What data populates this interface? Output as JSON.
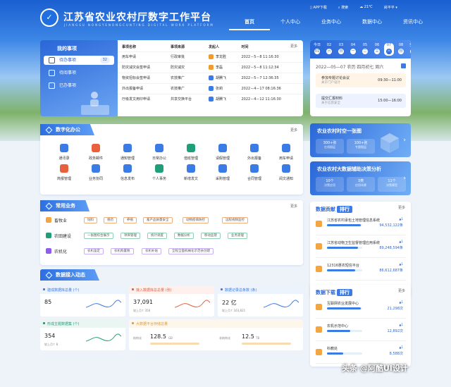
{
  "header": {
    "site_title": "江苏省农业农村厅数字工作平台",
    "site_subtitle": "JIANGSU NONGYENONGCUNTING DIGITAL WORK PLATFORM",
    "logo_text": "✓",
    "topbar": [
      "APP下载",
      "搜索",
      "21℃",
      "尚平平"
    ],
    "nav": [
      "首页",
      "个人中心",
      "业务中心",
      "数据中心",
      "资讯中心"
    ],
    "nav_active": "首页"
  },
  "todo": {
    "title": "我的事项",
    "items": [
      {
        "label": "待办事项",
        "count": "32"
      },
      {
        "label": "待阅事项"
      },
      {
        "label": "已办事项"
      }
    ]
  },
  "tasks": {
    "columns": [
      "事项名称",
      "事项来源",
      "发起人",
      "时间"
    ],
    "more": "更多",
    "rows": [
      {
        "name": "用车申请",
        "source": "行政审批",
        "person": "李龙胜",
        "time": "2022－5－8 11:16:30",
        "color": "#f19b2c"
      },
      {
        "name": "防灾减灾会签申请",
        "source": "防灾减灾",
        "person": "李磊",
        "time": "2022－5－8 11:12:34",
        "color": "#f19b2c"
      },
      {
        "name": "物资招标会签申请",
        "source": "农技推广",
        "person": "胡腾飞",
        "time": "2022－5－7 12:36:35",
        "color": "#3a7be6"
      },
      {
        "name": "外出报备申请",
        "source": "农技推广",
        "person": "张莉",
        "time": "2022－4－17 08:16:36",
        "color": "#3a7be6"
      },
      {
        "name": "厅级发文用印申请",
        "source": "共享交换平台",
        "person": "胡腾飞",
        "time": "2022－4－12 11:16:30",
        "color": "#3a7be6"
      }
    ]
  },
  "calendar": {
    "days": [
      {
        "top": "今日",
        "num": "01"
      },
      {
        "top": "02",
        "num": "六"
      },
      {
        "top": "03",
        "num": "日"
      },
      {
        "top": "04",
        "num": "一"
      },
      {
        "top": "05",
        "num": "二"
      },
      {
        "top": "06",
        "num": "三"
      },
      {
        "top": "07",
        "num": "六"
      },
      {
        "top": "08",
        "num": "日"
      },
      {
        "top": "全部",
        "num": "五"
      }
    ],
    "active_index": 6,
    "date_line": "2022—05—07  农历  四月初七  周六",
    "events": [
      {
        "title": "参加专题讨论会议",
        "sub": "关于门户设计",
        "time": "09:30—11:00"
      },
      {
        "title": "提交汇报材料",
        "sub": "关于信息安全",
        "time": "15:00—16:00"
      }
    ]
  },
  "panel_time": {
    "title": "农业农村时空一张图",
    "stats": [
      {
        "value": "300+张",
        "label": "在线图层"
      },
      {
        "value": "100+张",
        "label": "专题图层"
      }
    ]
  },
  "panel_ai": {
    "title": "农业农村大数据辅助决策分析",
    "stats": [
      {
        "value": "10个",
        "label": "决策应用"
      },
      {
        "value": "3类",
        "label": "应用场景"
      },
      {
        "value": "11个",
        "label": "决策模型"
      }
    ]
  },
  "office": {
    "title": "数字化办公",
    "more": "更多",
    "row1": [
      "通讯录",
      "政务邮件",
      "通知管理",
      "日常办公",
      "值班管理",
      "请假管理",
      "外出报备",
      "用车申请"
    ],
    "row2": [
      "简报管理",
      "业务协同",
      "信息发布",
      "个人事务",
      "新增发文",
      "采购管理",
      "合同管理",
      "阅文通知"
    ]
  },
  "business": {
    "title": "常用业务",
    "more": "更多",
    "rows": [
      {
        "label": "畜牧业",
        "tags": [
          "饲料",
          "兽药",
          "养殖",
          "畜产品质量安全",
          "动物疫病防控",
          "远程视频监控"
        ]
      },
      {
        "label": "农田建设",
        "tags": [
          "一张图综合展示",
          "项目管理",
          "统计调度",
          "数据分析",
          "移动监管",
          "业务受理"
        ]
      },
      {
        "label": "农机化",
        "tags": [
          "农机鉴定",
          "农机购置税",
          "农机补贴",
          "全程全面机械化示范县创建"
        ]
      }
    ]
  },
  "dataflow": {
    "title": "数据接入动态",
    "cards": [
      {
        "title": "建成数据库总量 (个)",
        "value": "85",
        "sub": "",
        "color": "#3a7be6"
      },
      {
        "title": "接入数据库总总量 (张)",
        "value": "37,091",
        "sub": "较上月↑ 356",
        "color": "#e8603c"
      },
      {
        "title": "数据记录总条数 (条)",
        "value": "22 亿",
        "sub": "较上月↑ 163,821",
        "color": "#3a7be6"
      },
      {
        "title": "形成主题数据集 (个)",
        "value": "354",
        "sub": "较上月↑ 8",
        "color": "#1f9e7a"
      },
      {
        "title": "大数据平台存储总量",
        "value": "128.5",
        "unit": "GB",
        "label": "结构化",
        "value2": "12.5",
        "unit2": "TB",
        "label2": "非结构化",
        "color": "#e89b2c"
      }
    ]
  },
  "rank_contrib": {
    "title": "数据贡献",
    "tag": "排行",
    "more": "更多",
    "items": [
      {
        "name": "江苏省农村承包土地管理信息系统",
        "value": "94,532,122条",
        "pct": 0.95,
        "up": "▲1"
      },
      {
        "name": "江苏省动物卫生监督管理应用系统",
        "value": "89,248,594条",
        "pct": 0.88,
        "up": "▲1"
      },
      {
        "name": "12316惠农短信平台",
        "value": "86,612,687条",
        "pct": 0.8,
        "up": "▲1"
      }
    ]
  },
  "rank_download": {
    "title": "数据下载",
    "tag": "排行",
    "more": "更多",
    "items": [
      {
        "name": "互联网农业发展中心",
        "value": "21,298次",
        "pct": 0.95,
        "up": "▲1"
      },
      {
        "name": "农机示范中心",
        "value": "12,892次",
        "pct": 0.65,
        "up": "▲1"
      },
      {
        "name": "科教处",
        "value": "8,588次",
        "pct": 0.45,
        "up": "▲1"
      }
    ]
  },
  "watermark": "头条 @阿酷UI设计"
}
